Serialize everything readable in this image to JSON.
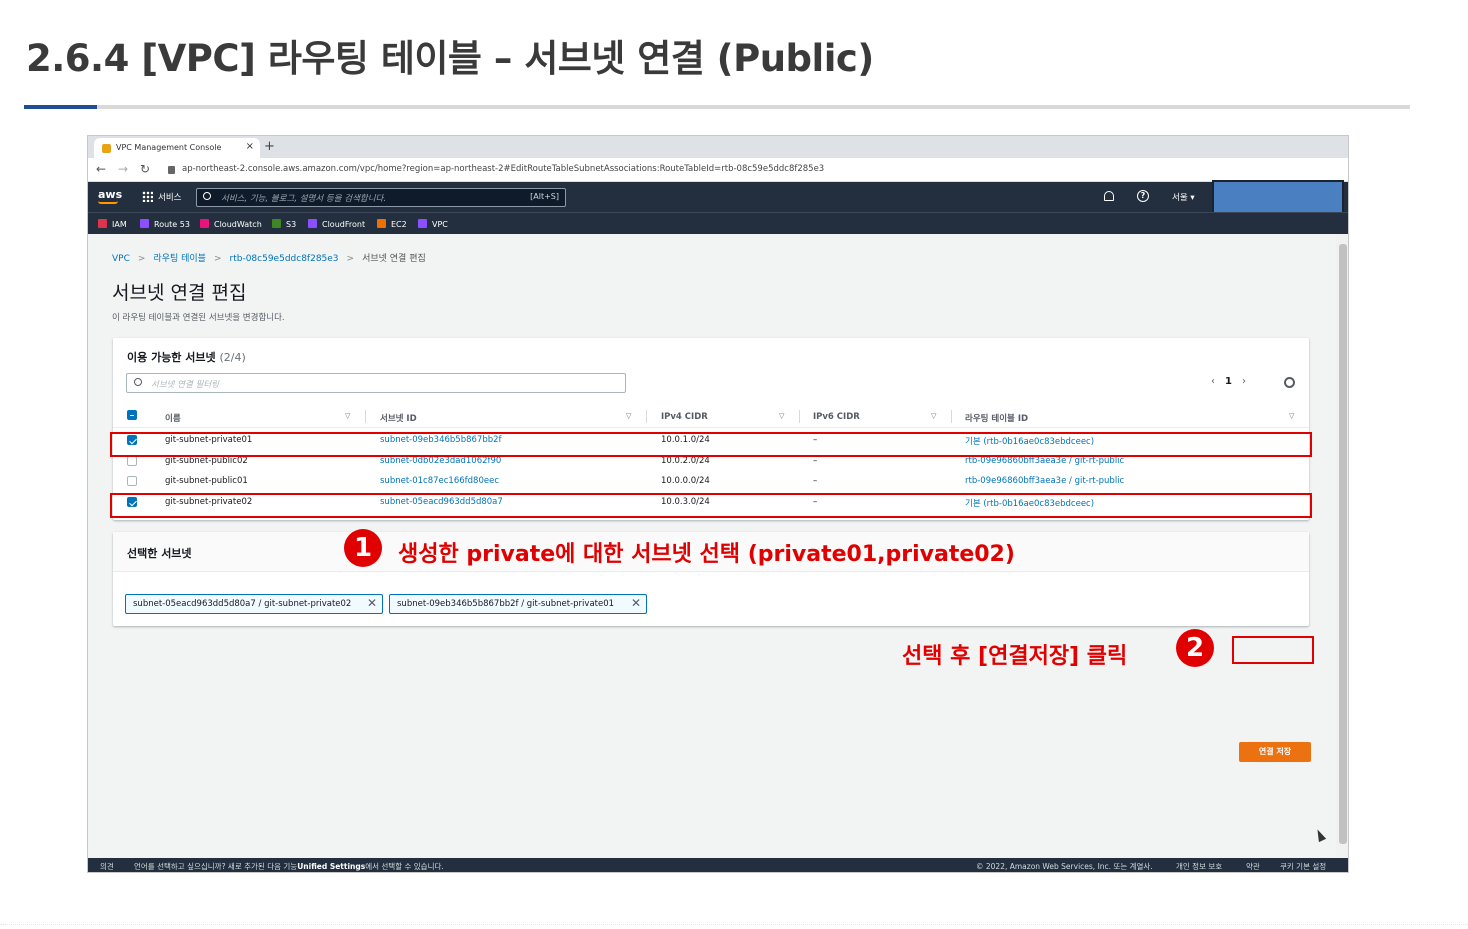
{
  "slide": {
    "title": "2.6.4 [VPC] 라우팅 테이블 – 서브넷 연결 (Public)"
  },
  "browser": {
    "tab_title": "VPC Management Console",
    "tab_close": "×",
    "new_tab": "+",
    "url": "ap-northeast-2.console.aws.amazon.com/vpc/home?region=ap-northeast-2#EditRouteTableSubnetAssociations:RouteTableId=rtb-08c59e5ddc8f285e3"
  },
  "aws_nav": {
    "logo": "aws",
    "services_label": "서비스",
    "search_placeholder": "서비스, 기능, 블로그, 설명서 등을 검색합니다.",
    "search_shortcut": "[Alt+S]",
    "region": "서울 ▾",
    "help_glyph": "?"
  },
  "favorites": [
    {
      "label": "IAM",
      "color": "#dd344c"
    },
    {
      "label": "Route 53",
      "color": "#8c4fff"
    },
    {
      "label": "CloudWatch",
      "color": "#e7157b"
    },
    {
      "label": "S3",
      "color": "#3f8624"
    },
    {
      "label": "CloudFront",
      "color": "#8c4fff"
    },
    {
      "label": "EC2",
      "color": "#ed7100"
    },
    {
      "label": "VPC",
      "color": "#8c4fff"
    }
  ],
  "breadcrumb": {
    "items": [
      "VPC",
      "라우팅 테이블",
      "rtb-08c59e5ddc8f285e3"
    ],
    "current": "서브넷 연결 편집",
    "separator": ">"
  },
  "page": {
    "title": "서브넷 연결 편집",
    "description": "이 라우팅 테이블과 연결된 서브넷을 변경합니다."
  },
  "available_subnets": {
    "title": "이용 가능한 서브넷",
    "count": "(2/4)",
    "filter_placeholder": "서브넷 연결 필터링",
    "pager": {
      "prev": "‹",
      "page": "1",
      "next": "›"
    },
    "columns": [
      "이름",
      "서브넷 ID",
      "IPv4 CIDR",
      "IPv6 CIDR",
      "라우팅 테이블 ID"
    ],
    "rows": [
      {
        "checked": true,
        "name": "git-subnet-private01",
        "subnet_id": "subnet-09eb346b5b867bb2f",
        "ipv4": "10.0.1.0/24",
        "ipv6": "–",
        "route_table": "기본 (rtb-0b16ae0c83ebdceec)"
      },
      {
        "checked": false,
        "name": "git-subnet-public02",
        "subnet_id": "subnet-0db02e3dad1062f90",
        "ipv4": "10.0.2.0/24",
        "ipv6": "–",
        "route_table": "rtb-09e96860bff3aea3e / git-rt-public"
      },
      {
        "checked": false,
        "name": "git-subnet-public01",
        "subnet_id": "subnet-01c87ec166fd80eec",
        "ipv4": "10.0.0.0/24",
        "ipv6": "–",
        "route_table": "rtb-09e96860bff3aea3e / git-rt-public"
      },
      {
        "checked": true,
        "name": "git-subnet-private02",
        "subnet_id": "subnet-05eacd963dd5d80a7",
        "ipv4": "10.0.3.0/24",
        "ipv6": "–",
        "route_table": "기본 (rtb-0b16ae0c83ebdceec)"
      }
    ]
  },
  "selected_subnets": {
    "title": "선택한 서브넷",
    "tokens": [
      "subnet-05eacd963dd5d80a7 / git-subnet-private02",
      "subnet-09eb346b5b867bb2f / git-subnet-private01"
    ],
    "remove_glyph": "✕"
  },
  "save_button": "연결 저장",
  "footer": {
    "feedback": "의견",
    "language_note": "언어를 선택하고 싶으십니까? 새로 추가된 다음 기능",
    "unified_settings": "Unified Settings",
    "language_note_tail": "에서 선택할 수 있습니다.",
    "copyright": "© 2022, Amazon Web Services, Inc. 또는 계열사.",
    "privacy": "개인 정보 보호",
    "terms": "약관",
    "cookies": "쿠키 기본 설정"
  },
  "annotations": {
    "step1_num": "1",
    "step1_text": "생성한 private에 대한 서브넷 선택 (private01,private02)",
    "step2_num": "2",
    "step2_text": "선택 후 [연결저장] 클릭",
    "color": "#e00000"
  }
}
